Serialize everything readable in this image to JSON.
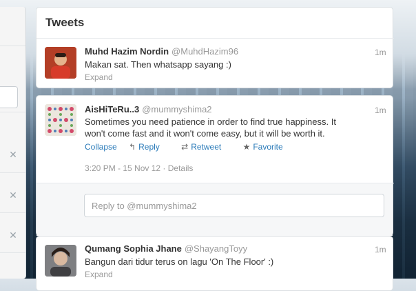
{
  "header": {
    "title": "Tweets"
  },
  "tweets": [
    {
      "fullname": "Muhd Hazim Nordin",
      "screen_name": "@MuhdHazim96",
      "time": "1m",
      "text": "Makan sat. Then whatsapp sayang :)",
      "expand_label": "Expand"
    },
    {
      "fullname": "AisHiTeRu..3",
      "screen_name": "@mummyshima2",
      "time": "1m",
      "text_line1": "Sometimes you need patience in order to find true happiness. It",
      "text_line2": "won't come fast and it won't come easy, but it will be worth it.",
      "collapse_label": "Collapse",
      "reply_label": "Reply",
      "retweet_label": "Retweet",
      "favorite_label": "Favorite",
      "timestamp": "3:20 PM - 15 Nov 12",
      "details_label": "Details",
      "reply_placeholder": "Reply to @mummyshima2"
    },
    {
      "fullname": "Qumang Sophia Jhane",
      "screen_name": "@ShayangToyy",
      "time": "1m",
      "text": "Bangun dari tidur terus on lagu 'On The Floor' :)",
      "expand_label": "Expand"
    }
  ],
  "icons": {
    "reply": "reply-arrow-icon",
    "retweet": "retweet-icon",
    "favorite": "star-icon",
    "close": "close-icon"
  },
  "colors": {
    "link": "#2b7bb9",
    "muted": "#999999",
    "text": "#333333"
  }
}
